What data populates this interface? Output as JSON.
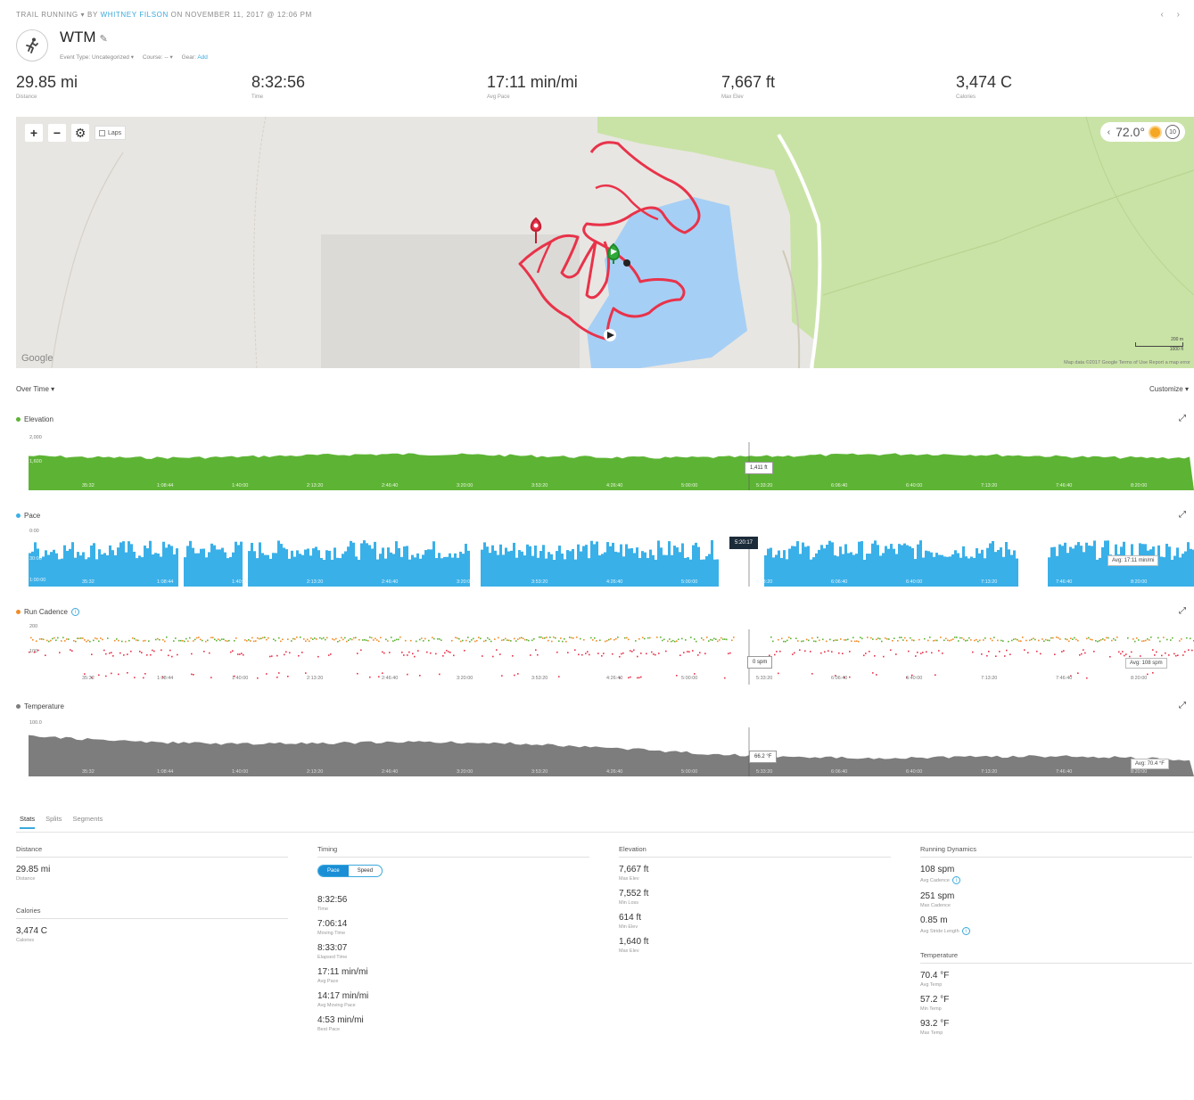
{
  "header": {
    "activity_type": "TRAIL RUNNING",
    "by": "BY",
    "author": "WHITNEY FILSON",
    "date": "ON NOVEMBER 11, 2017 @ 12:06 PM",
    "pager": "‹ ›",
    "title": "WTM",
    "event_type": "Event Type: Uncategorized",
    "course": "Course: --",
    "gear": "Gear:",
    "gear_link": "Add"
  },
  "summary": [
    {
      "value": "29.85 mi",
      "label": "Distance"
    },
    {
      "value": "8:32:56",
      "label": "Time"
    },
    {
      "value": "17:11 min/mi",
      "label": "Avg Pace"
    },
    {
      "value": "7,667 ft",
      "label": "Max Elev"
    },
    {
      "value": "3,474 C",
      "label": "Calories"
    }
  ],
  "map": {
    "zoom_in": "+",
    "zoom_out": "−",
    "laps_label": "Laps",
    "temperature": "72.0°",
    "wind": "10",
    "google": "Google",
    "attribution": "Map data ©2017 Google   Terms of Use   Report a map error",
    "scale_m": "200 m",
    "scale_ft": "1000 ft"
  },
  "over_time": {
    "dropdown": "Over Time ▾",
    "customize": "Customize ▾"
  },
  "charts": {
    "elevation": {
      "name": "Elevation",
      "ymax": "2,000",
      "mid": "1,600",
      "tooltip": "1,411 ft",
      "color": "#5db434"
    },
    "pace": {
      "name": "Pace",
      "ymax": "0:00",
      "mid": "30:00",
      "bottom": "1:00:00",
      "tooltip": "5:20:17",
      "avg": "Avg: 17:11 min/mi",
      "color": "#3ab0e8"
    },
    "cadence": {
      "name": "Run Cadence",
      "ymax": "200",
      "mid": "100",
      "tooltip": "0 spm",
      "avg": "Avg: 108 spm",
      "color": "#f28c28"
    },
    "temperature": {
      "name": "Temperature",
      "ymax": "100.0",
      "tooltip": "66.2 °F",
      "avg": "Avg: 70.4 °F",
      "color": "#7d7d7d"
    },
    "x_ticks": [
      "35:32",
      "1:08:44",
      "1:40:00",
      "2:13:20",
      "2:46:40",
      "3:20:00",
      "3:53:20",
      "4:26:40",
      "5:00:00",
      "5:33:20",
      "6:06:40",
      "6:40:00",
      "7:13:20",
      "7:46:40",
      "8:20:00"
    ]
  },
  "tabs": [
    "Stats",
    "Splits",
    "Segments"
  ],
  "stats": {
    "distance": {
      "header": "Distance",
      "value": "29.85 mi",
      "label": "Distance"
    },
    "calories": {
      "header": "Calories",
      "value": "3,474 C",
      "label": "Calories"
    },
    "timing": {
      "header": "Timing",
      "toggle_pace": "Pace",
      "toggle_speed": "Speed",
      "items": [
        {
          "value": "8:32:56",
          "label": "Time"
        },
        {
          "value": "7:06:14",
          "label": "Moving Time"
        },
        {
          "value": "8:33:07",
          "label": "Elapsed Time"
        },
        {
          "value": "17:11 min/mi",
          "label": "Avg Pace"
        },
        {
          "value": "14:17 min/mi",
          "label": "Avg Moving Pace"
        },
        {
          "value": "4:53 min/mi",
          "label": "Best Pace"
        }
      ]
    },
    "elevation": {
      "header": "Elevation",
      "items": [
        {
          "value": "7,667 ft",
          "label": "Max Elev"
        },
        {
          "value": "7,552 ft",
          "label": "Min Loss"
        },
        {
          "value": "614 ft",
          "label": "Min Elev"
        },
        {
          "value": "1,640 ft",
          "label": "Max Elev"
        }
      ]
    },
    "running_dynamics": {
      "header": "Running Dynamics",
      "items": [
        {
          "value": "108 spm",
          "label": "Avg Cadence"
        },
        {
          "value": "251 spm",
          "label": "Max Cadence"
        },
        {
          "value": "0.85 m",
          "label": "Avg Stride Length"
        }
      ]
    },
    "temperature": {
      "header": "Temperature",
      "items": [
        {
          "value": "70.4 °F",
          "label": "Avg Temp"
        },
        {
          "value": "57.2 °F",
          "label": "Min Temp"
        },
        {
          "value": "93.2 °F",
          "label": "Max Temp"
        }
      ]
    }
  },
  "colors": {
    "accent": "#3ba9dc",
    "route": "#e8334a",
    "start": "#2faa3a",
    "water": "#a6cff5",
    "park": "#c9e3a6"
  }
}
